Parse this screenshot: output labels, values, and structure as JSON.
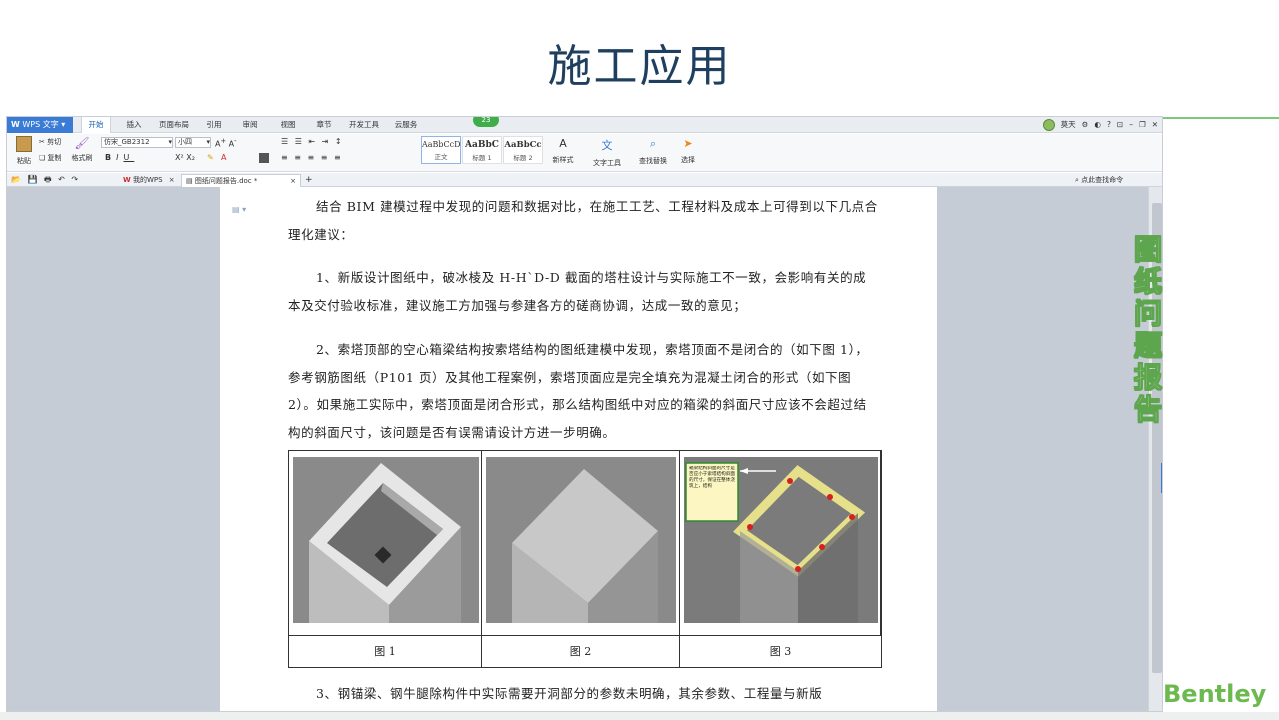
{
  "slide": {
    "title": "施工应用",
    "side_label": "图纸问题报告",
    "brand": "Bentley"
  },
  "wps": {
    "app_button": "WPS 文字",
    "menu_tabs": [
      "开始",
      "插入",
      "页面布局",
      "引用",
      "审阅",
      "视图",
      "章节",
      "开发工具",
      "云服务"
    ],
    "active_tab": "开始",
    "badge": "23",
    "user_name": "莫天",
    "ribbon": {
      "paste": "粘贴",
      "cut": "剪切",
      "copy": "复制",
      "format_painter": "格式刷",
      "font_name": "仿宋_GB2312",
      "font_size": "小四",
      "styles": [
        {
          "sample": "AaBbCcD",
          "name": "正文"
        },
        {
          "sample": "AaBbC",
          "name": "标题 1"
        },
        {
          "sample": "AaBbCc",
          "name": "标题 2"
        }
      ],
      "new_style": "新样式",
      "text_tools": "文字工具",
      "find_replace": "查找替换",
      "select": "选择"
    },
    "doc_tabs": {
      "my_wps": "我的WPS",
      "current_doc": "图纸问题报告.doc *"
    },
    "search_cmd": "点此查找命令"
  },
  "document": {
    "p1": "结合 BIM 建模过程中发现的问题和数据对比，在施工工艺、工程材料及成本上可得到以下几点合理化建议：",
    "p2": "1、新版设计图纸中，破冰棱及 H-H`D-D 截面的塔柱设计与实际施工不一致，会影响有关的成本及交付验收标准，建议施工方加强与参建各方的磋商协调，达成一致的意见；",
    "p3": "2、索塔顶部的空心箱梁结构按索塔结构的图纸建模中发现，索塔顶面不是闭合的（如下图 1），参考钢筋图纸（P101 页）及其他工程案例，索塔顶面应是完全填充为混凝土闭合的形式（如下图 2）。如果施工实际中，索塔顶面是闭合形式，那么结构图纸中对应的箱梁的斜面尺寸应该不会超过结构的斜面尺寸，该问题是否有误需请设计方进一步明确。",
    "p4": "3、钢锚梁、钢牛腿除构件中实际需要开洞部分的参数未明确，其余参数、工程量与新版",
    "captions": [
      "图 1",
      "图 2",
      "图 3"
    ],
    "fig3_note": "箱梁结构斜面的尺寸是否应小于索塔结构斜面的尺寸，保证在整体浇筑上，结构"
  }
}
